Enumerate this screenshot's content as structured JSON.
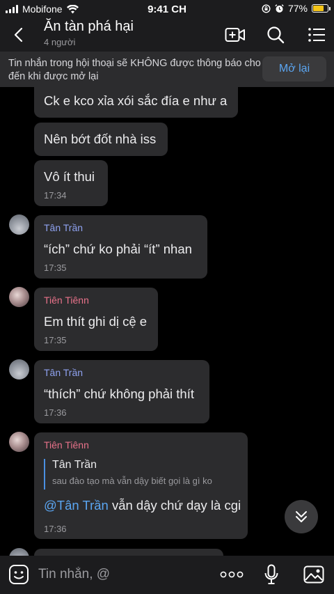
{
  "status_bar": {
    "carrier": "Mobifone",
    "time": "9:41 CH",
    "battery": "77%",
    "battery_level": 0.77,
    "battery_color": "#f5c518"
  },
  "header": {
    "title": "Ăn tàn phá hại",
    "subtitle": "4 người"
  },
  "notice": {
    "text": "Tin nhắn trong hội thoại sẽ KHÔNG được thông báo cho đến khi được mở lại",
    "button": "Mở lại"
  },
  "messages": [
    {
      "text": "Ck e kco xỉa xói sắc đía e như a"
    },
    {
      "text": "Nên bớt đốt nhà iss"
    },
    {
      "text": "Vô ít thui",
      "time": "17:34"
    },
    {
      "sender": "Tân Trần",
      "text": "“ích” chứ ko phải “ít” nhan",
      "time": "17:35"
    },
    {
      "sender": "Tiên Tiênn",
      "text": "Em thít ghi dị cệ e",
      "time": "17:35"
    },
    {
      "sender": "Tân Trần",
      "text": "“thích” chứ không phải thít",
      "time": "17:36"
    },
    {
      "sender": "Tiên Tiênn",
      "reply_to": {
        "name": "Tân Trần",
        "snippet": "sau đào tạo mà vẫn dậy biết gọi là gì ko"
      },
      "mention": "@Tân Trần",
      "text": " vẫn dậy chứ dạy là cgi",
      "time": "17:36"
    }
  ],
  "composer": {
    "placeholder": "Tin nhắn, @"
  },
  "colors": {
    "accent": "#5ba6f2",
    "sender_blue": "#8fa2f0",
    "sender_pink": "#e8728a",
    "bubble": "#2c2c2e",
    "background": "#000000"
  },
  "icons": [
    "back-icon",
    "add-video-call-icon",
    "search-icon",
    "menu-list-icon",
    "chevron-down-icon",
    "emoji-icon",
    "more-icon",
    "microphone-icon",
    "image-icon",
    "wifi-icon",
    "alarm-icon",
    "lock-rotation-icon"
  ]
}
